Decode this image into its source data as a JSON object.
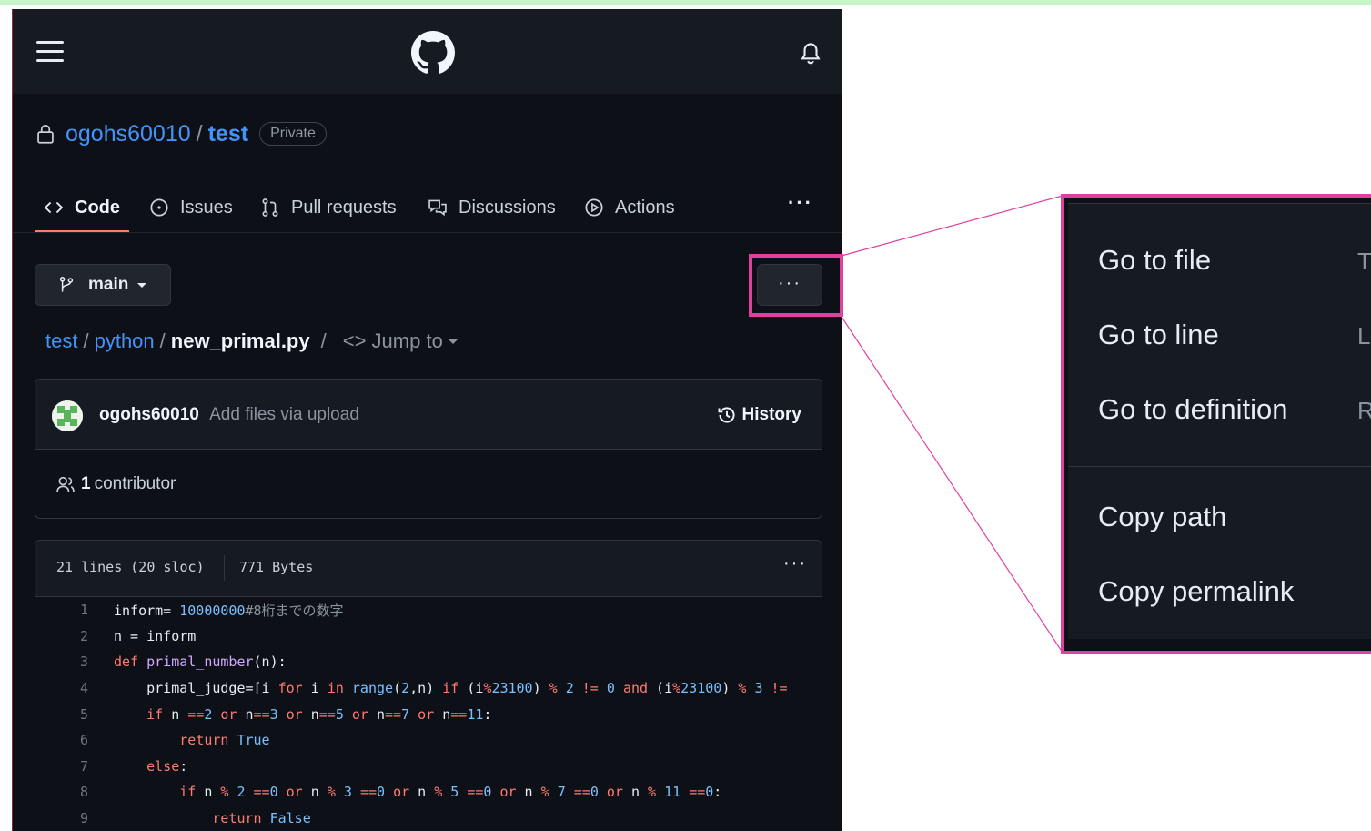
{
  "colors": {
    "accent_link": "#4493f8",
    "tab_underline": "#f78166",
    "callout": "#e040a0",
    "bg": "#0d1117"
  },
  "header": {
    "menu_icon": "hamburger-icon",
    "logo": "github-logo",
    "notification_icon": "bell-icon"
  },
  "repo": {
    "owner": "ogohs60010",
    "separator": "/",
    "name": "test",
    "visibility": "Private"
  },
  "tabs": [
    {
      "label": "Code",
      "icon": "code-icon",
      "active": true
    },
    {
      "label": "Issues",
      "icon": "issue-icon"
    },
    {
      "label": "Pull requests",
      "icon": "pull-request-icon"
    },
    {
      "label": "Discussions",
      "icon": "discussion-icon"
    },
    {
      "label": "Actions",
      "icon": "play-icon"
    }
  ],
  "tabs_more": "···",
  "branch": {
    "name": "main",
    "icon": "branch-icon"
  },
  "file_more": "···",
  "breadcrumb": {
    "root": "test",
    "sep": "/",
    "folder": "python",
    "file": "new_primal.py",
    "jump_sep": "/",
    "jump": "<> Jump to"
  },
  "commit": {
    "author": "ogohs60010",
    "message": "Add files via upload",
    "history": "History"
  },
  "contributors": {
    "count": "1",
    "label": "contributor"
  },
  "code": {
    "lines_info": "21 lines (20 sloc)",
    "size": "771 Bytes",
    "more": "···",
    "line_numbers": [
      "1",
      "2",
      "3",
      "4",
      "5",
      "6",
      "7",
      "8",
      "9"
    ]
  },
  "menu": {
    "items": [
      {
        "label": "Go to file",
        "key": "T"
      },
      {
        "label": "Go to line",
        "key": "L"
      },
      {
        "label": "Go to definition",
        "key": "R"
      },
      {
        "label": "Copy path",
        "key": ""
      },
      {
        "label": "Copy permalink",
        "key": ""
      }
    ]
  }
}
